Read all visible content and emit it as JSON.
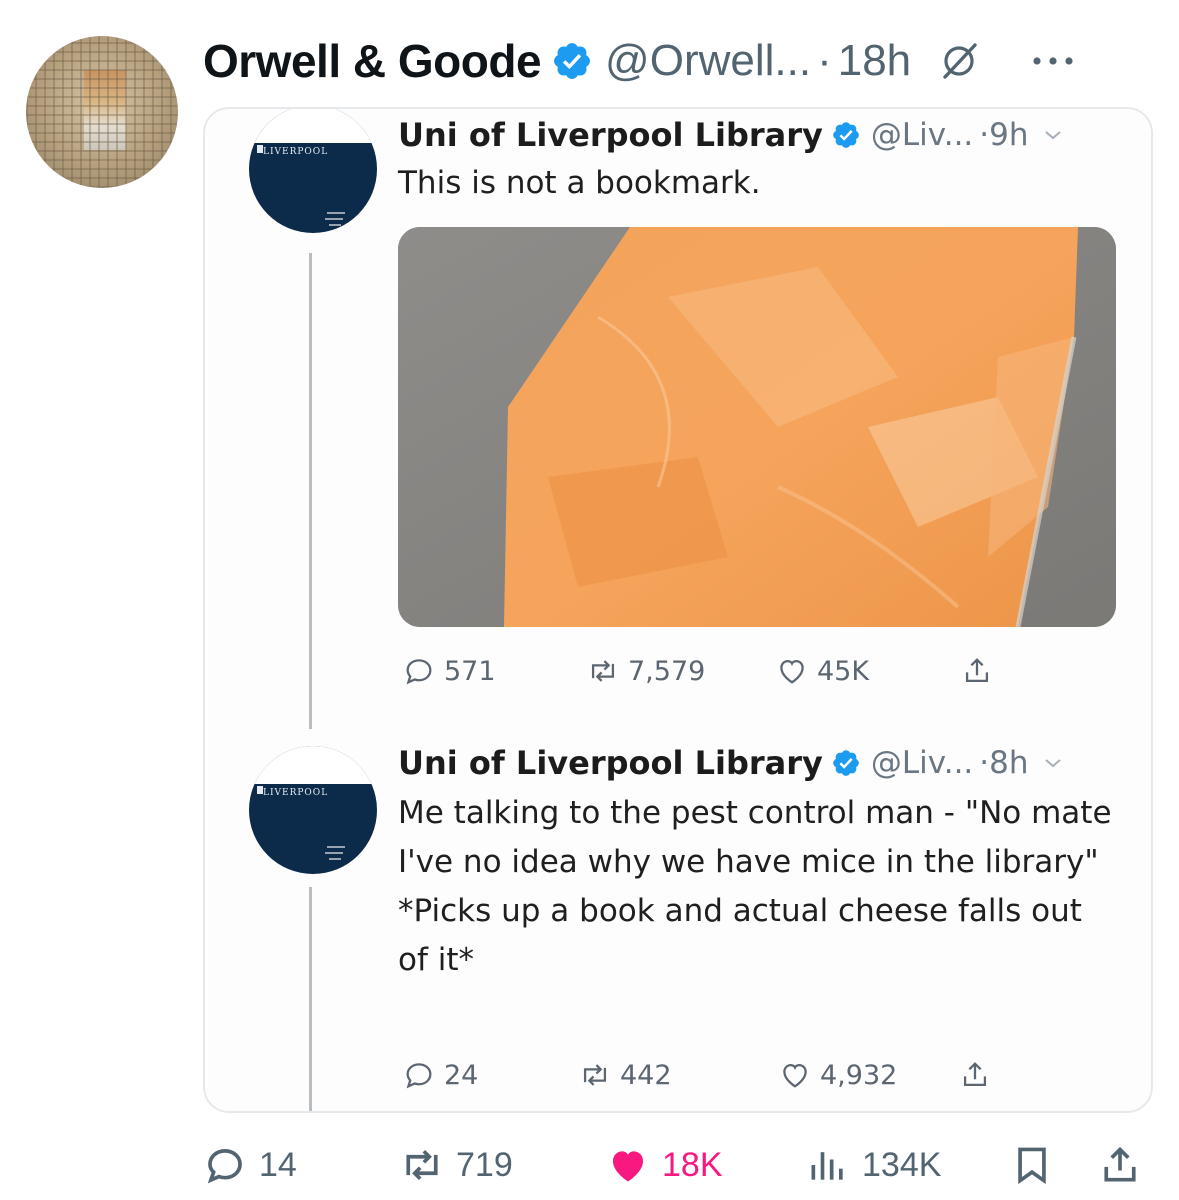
{
  "post": {
    "author": "Orwell & Goode",
    "handle": "@Orwell...",
    "separator": "·",
    "time": "18h",
    "icons": {
      "verified": "verified-badge-icon",
      "grok": "grok-icon",
      "more": "more-icon"
    }
  },
  "quoted_screenshot": {
    "tweets": [
      {
        "name": "Uni of Liverpool Library",
        "handle": "@Liv...",
        "time": "·9h",
        "text": "This is not a bookmark.",
        "image": "cheese-slice-photo",
        "stats": {
          "replies": "571",
          "retweets": "7,579",
          "likes": "45K"
        }
      },
      {
        "name": "Uni of Liverpool Library",
        "handle": "@Liv...",
        "time": "·8h",
        "text": "Me talking to the pest control man - \"No mate I've no idea why we have mice in the library\"\n*Picks up a book and actual cheese falls out of it*",
        "stats": {
          "replies": "24",
          "retweets": "442",
          "likes": "4,932"
        }
      }
    ],
    "avatar_logo_text": "LIVERPOOL"
  },
  "engagement": {
    "replies": "14",
    "reposts": "719",
    "likes": "18K",
    "views": "134K",
    "liked": true,
    "like_color": "#f91880",
    "accent_color": "#1d9bf0"
  }
}
